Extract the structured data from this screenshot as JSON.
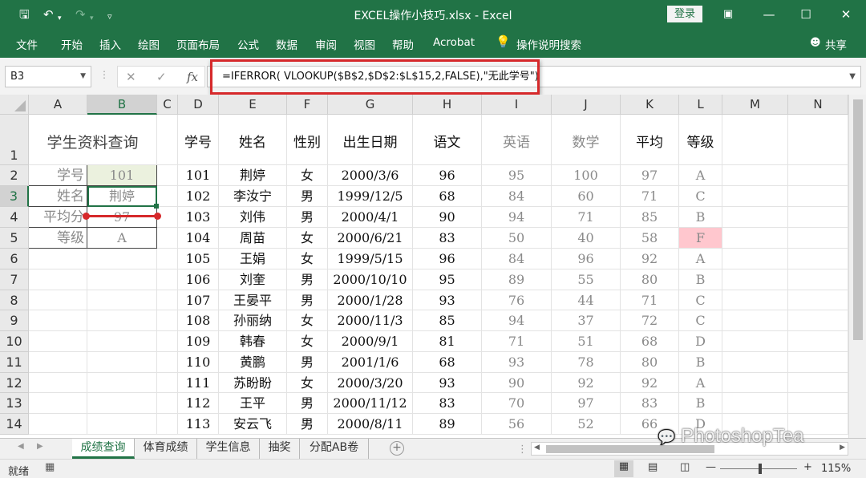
{
  "window": {
    "title": "EXCEL操作小技巧.xlsx - Excel",
    "login_label": "登录"
  },
  "ribbon": {
    "tabs": [
      "文件",
      "开始",
      "插入",
      "绘图",
      "页面布局",
      "公式",
      "数据",
      "审阅",
      "视图",
      "帮助",
      "Acrobat"
    ],
    "search_label": "操作说明搜索",
    "share_label": "共享"
  },
  "formula_bar": {
    "name_box": "B3",
    "formula": "=IFERROR( VLOOKUP($B$2,$D$2:$L$15,2,FALSE),\"无此学号\")"
  },
  "columns": [
    "A",
    "B",
    "C",
    "D",
    "E",
    "F",
    "G",
    "H",
    "I",
    "J",
    "K",
    "L",
    "M",
    "N"
  ],
  "rows": [
    "1",
    "2",
    "3",
    "4",
    "5",
    "6",
    "7",
    "8",
    "9",
    "10",
    "11",
    "12",
    "13",
    "14"
  ],
  "lookup": {
    "title": "学生资料查询",
    "labels": [
      "学号",
      "姓名",
      "平均分",
      "等级"
    ],
    "values": [
      "101",
      "荆婷",
      "97",
      "A"
    ]
  },
  "table": {
    "headers": [
      "学号",
      "姓名",
      "性别",
      "出生日期",
      "语文",
      "英语",
      "数学",
      "平均",
      "等级"
    ],
    "rows": [
      [
        "101",
        "荆婷",
        "女",
        "2000/3/6",
        "96",
        "95",
        "100",
        "97",
        "A"
      ],
      [
        "102",
        "李汝宁",
        "男",
        "1999/12/5",
        "68",
        "84",
        "60",
        "71",
        "C"
      ],
      [
        "103",
        "刘伟",
        "男",
        "2000/4/1",
        "90",
        "94",
        "71",
        "85",
        "B"
      ],
      [
        "104",
        "周苗",
        "女",
        "2000/6/21",
        "83",
        "50",
        "40",
        "58",
        "F"
      ],
      [
        "105",
        "王娟",
        "女",
        "1999/5/15",
        "96",
        "84",
        "96",
        "92",
        "A"
      ],
      [
        "106",
        "刘奎",
        "男",
        "2000/10/10",
        "95",
        "89",
        "55",
        "80",
        "B"
      ],
      [
        "107",
        "王晏平",
        "男",
        "2000/1/28",
        "93",
        "76",
        "44",
        "71",
        "C"
      ],
      [
        "108",
        "孙丽纳",
        "女",
        "2000/11/3",
        "85",
        "94",
        "37",
        "72",
        "C"
      ],
      [
        "109",
        "韩春",
        "女",
        "2000/9/1",
        "81",
        "71",
        "51",
        "68",
        "D"
      ],
      [
        "110",
        "黄鹏",
        "男",
        "2001/1/6",
        "68",
        "93",
        "78",
        "80",
        "B"
      ],
      [
        "111",
        "苏盼盼",
        "女",
        "2000/3/20",
        "93",
        "90",
        "92",
        "92",
        "A"
      ],
      [
        "112",
        "王平",
        "男",
        "2000/11/12",
        "83",
        "70",
        "97",
        "83",
        "B"
      ],
      [
        "113",
        "安云飞",
        "男",
        "2000/8/11",
        "89",
        "56",
        "52",
        "66",
        "D"
      ]
    ]
  },
  "sheets": [
    "成绩查询",
    "体育成绩",
    "学生信息",
    "抽奖",
    "分配AB卷"
  ],
  "status": {
    "ready": "就绪",
    "zoom": "115%"
  },
  "watermark": "PhotoshopTea",
  "colors": {
    "accent": "#217346",
    "highlight_red": "#d6292b",
    "fail_fill": "#ffc7ce",
    "input_fill": "#ebf1de"
  }
}
